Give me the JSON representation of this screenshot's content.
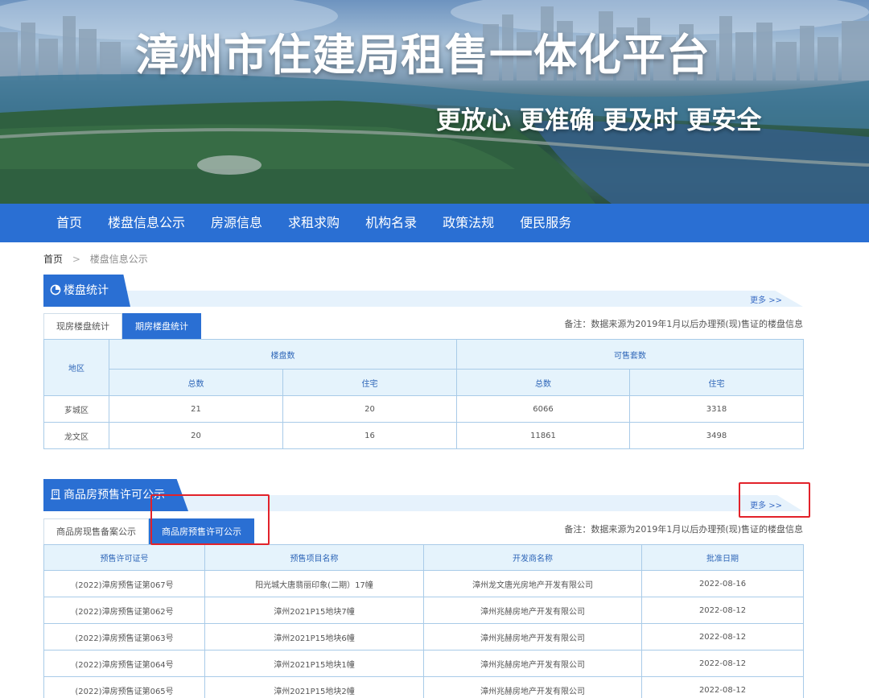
{
  "banner": {
    "title": "漳州市住建局租售一体化平台",
    "slogan": "更放心  更准确  更及时  更安全"
  },
  "nav": {
    "items": [
      "首页",
      "楼盘信息公示",
      "房源信息",
      "求租求购",
      "机构名录",
      "政策法规",
      "便民服务"
    ]
  },
  "breadcrumb": {
    "home": "首页",
    "separator": ">",
    "current": "楼盘信息公示"
  },
  "section1": {
    "title": "楼盘统计",
    "icon": "pie-chart-icon",
    "more": "更多 >>",
    "tabs": [
      "现房楼盘统计",
      "期房楼盘统计"
    ],
    "active_tab": 1,
    "note": "备注：数据来源为2019年1月以后办理预(现)售证的楼盘信息",
    "table": {
      "h_region": "地区",
      "h_projects": "楼盘数",
      "h_available": "可售套数",
      "h_total1": "总数",
      "h_res1": "住宅",
      "h_total2": "总数",
      "h_res2": "住宅",
      "rows": [
        [
          "芗城区",
          "21",
          "20",
          "6066",
          "3318"
        ],
        [
          "龙文区",
          "20",
          "16",
          "11861",
          "3498"
        ]
      ]
    }
  },
  "section2": {
    "title": "商品房预售许可公示",
    "icon": "building-icon",
    "more": "更多 >>",
    "tabs": [
      "商品房现售备案公示",
      "商品房预售许可公示"
    ],
    "active_tab": 1,
    "note": "备注：数据来源为2019年1月以后办理预(现)售证的楼盘信息",
    "table": {
      "headers": [
        "预售许可证号",
        "预售项目名称",
        "开发商名称",
        "批准日期"
      ],
      "rows": [
        [
          "(2022)漳房预售证第067号",
          "阳光城大唐翡丽印象(二期）17幢",
          "漳州龙文唐光房地产开发有限公司",
          "2022-08-16"
        ],
        [
          "(2022)漳房预售证第062号",
          "漳州2021P15地块7幢",
          "漳州兆赫房地产开发有限公司",
          "2022-08-12"
        ],
        [
          "(2022)漳房预售证第063号",
          "漳州2021P15地块6幢",
          "漳州兆赫房地产开发有限公司",
          "2022-08-12"
        ],
        [
          "(2022)漳房预售证第064号",
          "漳州2021P15地块1幢",
          "漳州兆赫房地产开发有限公司",
          "2022-08-12"
        ],
        [
          "(2022)漳房预售证第065号",
          "漳州2021P15地块2幢",
          "漳州兆赫房地产开发有限公司",
          "2022-08-12"
        ]
      ]
    }
  },
  "colors": {
    "primary": "#2a6fd3",
    "header_bg": "#e5f3fc",
    "border": "#a9cbe8",
    "highlight": "#e2222a"
  }
}
